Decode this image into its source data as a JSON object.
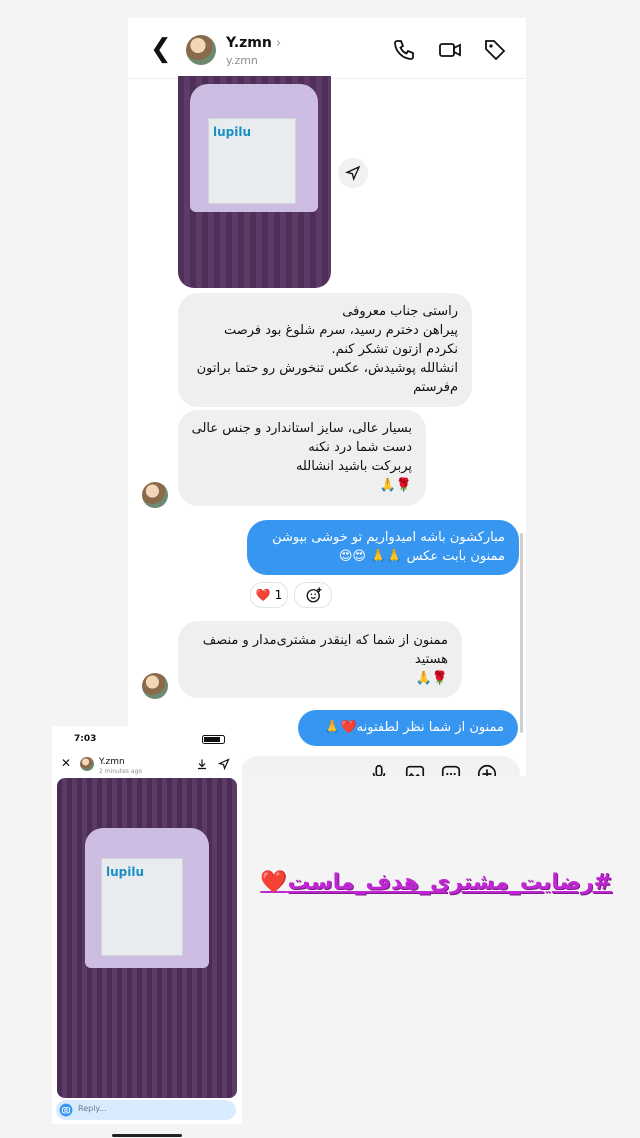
{
  "header": {
    "name": "Y.zmn",
    "username": "y.zmn",
    "back_icon": "chevron-left-icon",
    "call_icon": "phone-icon",
    "video_icon": "video-icon",
    "tag_icon": "tag-icon"
  },
  "product_image": {
    "brand": "lupilu"
  },
  "messages": [
    {
      "from": "them",
      "lines": [
        "راستی جناب معروفی",
        "پیراهن دخترم رسید، سرم شلوغ بود فرصت",
        "نکردم ازتون تشکر کنم.",
        "انشالله پوشیدش، عکس تنخورش رو حتما براتون",
        "م‌فرستم"
      ]
    },
    {
      "from": "them",
      "lines": [
        "بسیار عالی، سایز استاندارد و جنس عالی",
        "دست شما درد نکنه",
        "پربرکت باشید انشالله",
        "🌹🙏"
      ]
    },
    {
      "from": "me",
      "lines": [
        "مبارکشون باشه امیدواریم تو خوشی بپوشن",
        "ممنون بابت عکس 🙏🙏 😍😍"
      ]
    },
    {
      "from": "them",
      "lines": [
        "ممنون از شما که اینقدر مشتری‌مدار و منصف",
        "هستید",
        "🌹🙏"
      ]
    },
    {
      "from": "me",
      "lines": [
        "ممنون از شما  نظر لطفتونه❤️🙏"
      ]
    }
  ],
  "reaction": {
    "emoji": "❤️",
    "count": "1"
  },
  "story": {
    "time": "7:03",
    "name": "Y.zmn",
    "posted": "2 minutes ago",
    "reply_placeholder": "Reply...",
    "brand": "lupilu"
  },
  "caption": {
    "hashtag": "#رضایت_مشتری_هدف_ماست",
    "heart": "❤️"
  }
}
